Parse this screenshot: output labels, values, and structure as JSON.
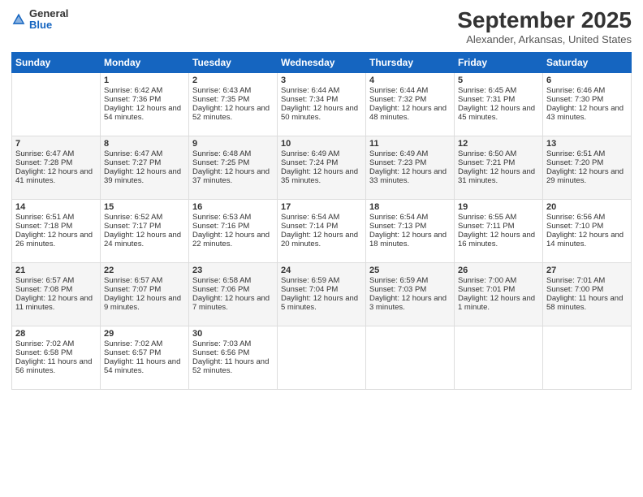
{
  "header": {
    "logo": {
      "general": "General",
      "blue": "Blue"
    },
    "title": "September 2025",
    "location": "Alexander, Arkansas, United States"
  },
  "weekdays": [
    "Sunday",
    "Monday",
    "Tuesday",
    "Wednesday",
    "Thursday",
    "Friday",
    "Saturday"
  ],
  "weeks": [
    [
      {
        "day": "",
        "sunrise": "",
        "sunset": "",
        "daylight": ""
      },
      {
        "day": "1",
        "sunrise": "Sunrise: 6:42 AM",
        "sunset": "Sunset: 7:36 PM",
        "daylight": "Daylight: 12 hours and 54 minutes."
      },
      {
        "day": "2",
        "sunrise": "Sunrise: 6:43 AM",
        "sunset": "Sunset: 7:35 PM",
        "daylight": "Daylight: 12 hours and 52 minutes."
      },
      {
        "day": "3",
        "sunrise": "Sunrise: 6:44 AM",
        "sunset": "Sunset: 7:34 PM",
        "daylight": "Daylight: 12 hours and 50 minutes."
      },
      {
        "day": "4",
        "sunrise": "Sunrise: 6:44 AM",
        "sunset": "Sunset: 7:32 PM",
        "daylight": "Daylight: 12 hours and 48 minutes."
      },
      {
        "day": "5",
        "sunrise": "Sunrise: 6:45 AM",
        "sunset": "Sunset: 7:31 PM",
        "daylight": "Daylight: 12 hours and 45 minutes."
      },
      {
        "day": "6",
        "sunrise": "Sunrise: 6:46 AM",
        "sunset": "Sunset: 7:30 PM",
        "daylight": "Daylight: 12 hours and 43 minutes."
      }
    ],
    [
      {
        "day": "7",
        "sunrise": "Sunrise: 6:47 AM",
        "sunset": "Sunset: 7:28 PM",
        "daylight": "Daylight: 12 hours and 41 minutes."
      },
      {
        "day": "8",
        "sunrise": "Sunrise: 6:47 AM",
        "sunset": "Sunset: 7:27 PM",
        "daylight": "Daylight: 12 hours and 39 minutes."
      },
      {
        "day": "9",
        "sunrise": "Sunrise: 6:48 AM",
        "sunset": "Sunset: 7:25 PM",
        "daylight": "Daylight: 12 hours and 37 minutes."
      },
      {
        "day": "10",
        "sunrise": "Sunrise: 6:49 AM",
        "sunset": "Sunset: 7:24 PM",
        "daylight": "Daylight: 12 hours and 35 minutes."
      },
      {
        "day": "11",
        "sunrise": "Sunrise: 6:49 AM",
        "sunset": "Sunset: 7:23 PM",
        "daylight": "Daylight: 12 hours and 33 minutes."
      },
      {
        "day": "12",
        "sunrise": "Sunrise: 6:50 AM",
        "sunset": "Sunset: 7:21 PM",
        "daylight": "Daylight: 12 hours and 31 minutes."
      },
      {
        "day": "13",
        "sunrise": "Sunrise: 6:51 AM",
        "sunset": "Sunset: 7:20 PM",
        "daylight": "Daylight: 12 hours and 29 minutes."
      }
    ],
    [
      {
        "day": "14",
        "sunrise": "Sunrise: 6:51 AM",
        "sunset": "Sunset: 7:18 PM",
        "daylight": "Daylight: 12 hours and 26 minutes."
      },
      {
        "day": "15",
        "sunrise": "Sunrise: 6:52 AM",
        "sunset": "Sunset: 7:17 PM",
        "daylight": "Daylight: 12 hours and 24 minutes."
      },
      {
        "day": "16",
        "sunrise": "Sunrise: 6:53 AM",
        "sunset": "Sunset: 7:16 PM",
        "daylight": "Daylight: 12 hours and 22 minutes."
      },
      {
        "day": "17",
        "sunrise": "Sunrise: 6:54 AM",
        "sunset": "Sunset: 7:14 PM",
        "daylight": "Daylight: 12 hours and 20 minutes."
      },
      {
        "day": "18",
        "sunrise": "Sunrise: 6:54 AM",
        "sunset": "Sunset: 7:13 PM",
        "daylight": "Daylight: 12 hours and 18 minutes."
      },
      {
        "day": "19",
        "sunrise": "Sunrise: 6:55 AM",
        "sunset": "Sunset: 7:11 PM",
        "daylight": "Daylight: 12 hours and 16 minutes."
      },
      {
        "day": "20",
        "sunrise": "Sunrise: 6:56 AM",
        "sunset": "Sunset: 7:10 PM",
        "daylight": "Daylight: 12 hours and 14 minutes."
      }
    ],
    [
      {
        "day": "21",
        "sunrise": "Sunrise: 6:57 AM",
        "sunset": "Sunset: 7:08 PM",
        "daylight": "Daylight: 12 hours and 11 minutes."
      },
      {
        "day": "22",
        "sunrise": "Sunrise: 6:57 AM",
        "sunset": "Sunset: 7:07 PM",
        "daylight": "Daylight: 12 hours and 9 minutes."
      },
      {
        "day": "23",
        "sunrise": "Sunrise: 6:58 AM",
        "sunset": "Sunset: 7:06 PM",
        "daylight": "Daylight: 12 hours and 7 minutes."
      },
      {
        "day": "24",
        "sunrise": "Sunrise: 6:59 AM",
        "sunset": "Sunset: 7:04 PM",
        "daylight": "Daylight: 12 hours and 5 minutes."
      },
      {
        "day": "25",
        "sunrise": "Sunrise: 6:59 AM",
        "sunset": "Sunset: 7:03 PM",
        "daylight": "Daylight: 12 hours and 3 minutes."
      },
      {
        "day": "26",
        "sunrise": "Sunrise: 7:00 AM",
        "sunset": "Sunset: 7:01 PM",
        "daylight": "Daylight: 12 hours and 1 minute."
      },
      {
        "day": "27",
        "sunrise": "Sunrise: 7:01 AM",
        "sunset": "Sunset: 7:00 PM",
        "daylight": "Daylight: 11 hours and 58 minutes."
      }
    ],
    [
      {
        "day": "28",
        "sunrise": "Sunrise: 7:02 AM",
        "sunset": "Sunset: 6:58 PM",
        "daylight": "Daylight: 11 hours and 56 minutes."
      },
      {
        "day": "29",
        "sunrise": "Sunrise: 7:02 AM",
        "sunset": "Sunset: 6:57 PM",
        "daylight": "Daylight: 11 hours and 54 minutes."
      },
      {
        "day": "30",
        "sunrise": "Sunrise: 7:03 AM",
        "sunset": "Sunset: 6:56 PM",
        "daylight": "Daylight: 11 hours and 52 minutes."
      },
      {
        "day": "",
        "sunrise": "",
        "sunset": "",
        "daylight": ""
      },
      {
        "day": "",
        "sunrise": "",
        "sunset": "",
        "daylight": ""
      },
      {
        "day": "",
        "sunrise": "",
        "sunset": "",
        "daylight": ""
      },
      {
        "day": "",
        "sunrise": "",
        "sunset": "",
        "daylight": ""
      }
    ]
  ]
}
